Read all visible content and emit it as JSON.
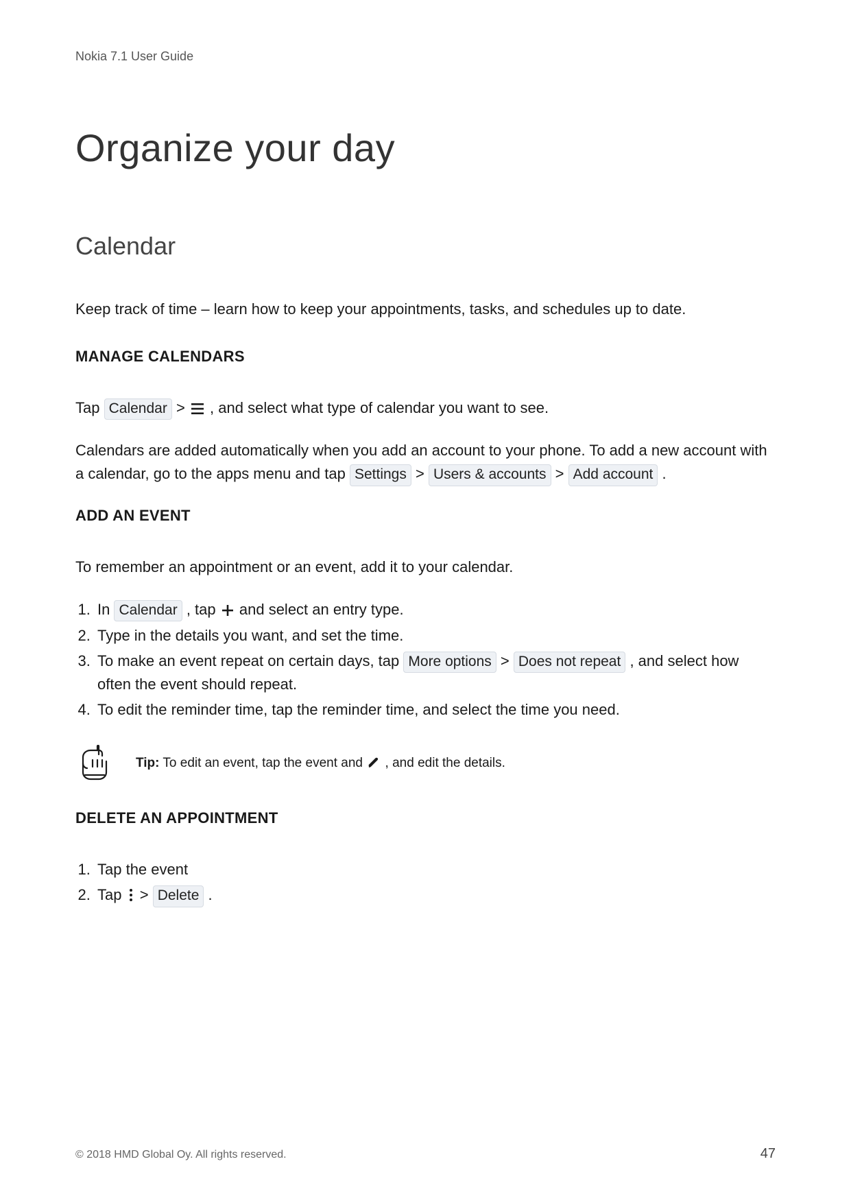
{
  "header": {
    "running_title": "Nokia 7.1 User Guide"
  },
  "chapter": {
    "title": "Organize your day"
  },
  "section": {
    "title": "Calendar",
    "intro": "Keep track of time – learn how to keep your appointments, tasks, and schedules up to date."
  },
  "manage": {
    "heading": "MANAGE CALENDARS",
    "line1_pre": "Tap ",
    "line1_ui_calendar": "Calendar",
    "line1_gt": " > ",
    "line1_post": ", and select what type of calendar you want to see.",
    "para2_a": "Calendars are added automatically when you add an account to your phone. To add a new account with a calendar, go to the apps menu and tap ",
    "para2_settings": "Settings",
    "para2_gt1": " > ",
    "para2_users": "Users & accounts",
    "para2_gt2": " > ",
    "para2_add": "Add account",
    "para2_end": " ."
  },
  "add_event": {
    "heading": "ADD AN EVENT",
    "intro": "To remember an appointment or an event, add it to your calendar.",
    "steps": {
      "s1_a": "In ",
      "s1_calendar": "Calendar",
      "s1_b": " , tap ",
      "s1_c": " and select an entry type.",
      "s2": "Type in the details you want, and set the time.",
      "s3_a": "To make an event repeat on certain days, tap ",
      "s3_more": "More options",
      "s3_gt": " > ",
      "s3_repeat": "Does not repeat",
      "s3_b": " , and select how often the event should repeat.",
      "s4": "To edit the reminder time, tap the reminder time, and select the time you need."
    },
    "tip_label": "Tip:",
    "tip_a": "To edit an event, tap the event and ",
    "tip_b": ", and edit the details."
  },
  "delete": {
    "heading": "DELETE AN APPOINTMENT",
    "s1": "Tap the event",
    "s2_a": "Tap ",
    "s2_gt": " > ",
    "s2_delete": "Delete",
    "s2_end": " ."
  },
  "footer": {
    "copyright": "© 2018 HMD Global Oy. All rights reserved.",
    "page_number": "47"
  },
  "icons": {
    "hamburger": "hamburger-icon",
    "plus": "plus-icon",
    "pencil": "pencil-icon",
    "more_vert": "more-vert-icon",
    "hand_point": "hand-point-icon"
  }
}
